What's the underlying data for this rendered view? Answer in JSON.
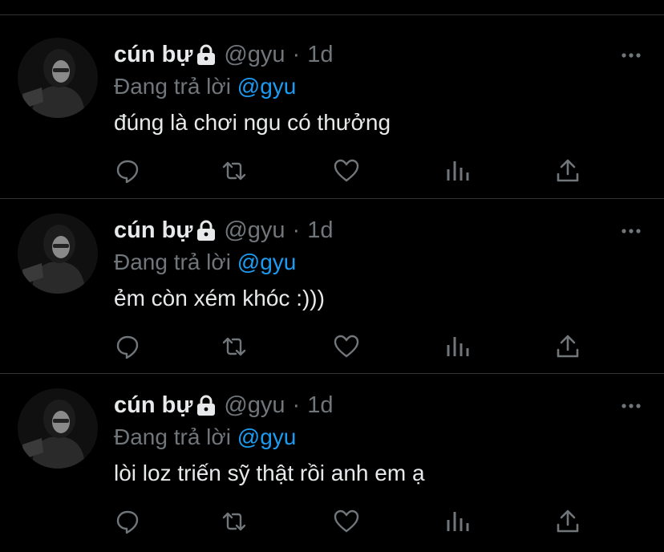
{
  "colors": {
    "background": "#000000",
    "text": "#e7e9ea",
    "muted": "#71767b",
    "mention": "#1d9bf0",
    "divider": "#2f3336"
  },
  "tweets": [
    {
      "name": "cún bự",
      "handle": "@gyu",
      "separator": "·",
      "time": "1d",
      "reply_prefix": "Đang trả lời",
      "reply_to": "@gyu",
      "text": "đúng là chơi ngu có thưởng",
      "icons": [
        "avatar",
        "lock-icon",
        "more-icon",
        "reply-icon",
        "retweet-icon",
        "like-icon",
        "views-icon",
        "share-icon"
      ]
    },
    {
      "name": "cún bự",
      "handle": "@gyu",
      "separator": "·",
      "time": "1d",
      "reply_prefix": "Đang trả lời",
      "reply_to": "@gyu",
      "text": "ẻm còn xém khóc :)))",
      "icons": [
        "avatar",
        "lock-icon",
        "more-icon",
        "reply-icon",
        "retweet-icon",
        "like-icon",
        "views-icon",
        "share-icon"
      ]
    },
    {
      "name": "cún bự",
      "handle": "@gyu",
      "separator": "·",
      "time": "1d",
      "reply_prefix": "Đang trả lời",
      "reply_to": "@gyu",
      "text": "lòi loz triến sỹ thật rồi anh em ạ",
      "icons": [
        "avatar",
        "lock-icon",
        "more-icon",
        "reply-icon",
        "retweet-icon",
        "like-icon",
        "views-icon",
        "share-icon"
      ]
    }
  ]
}
